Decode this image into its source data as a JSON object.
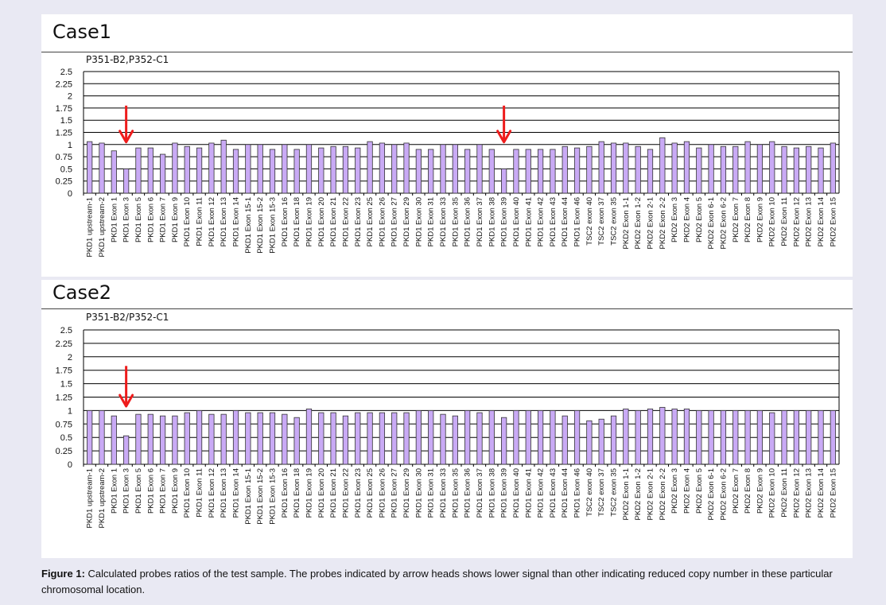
{
  "panels": [
    {
      "case_title": "Case1"
    },
    {
      "case_title": "Case2"
    }
  ],
  "caption": {
    "label": "Figure 1:",
    "text": "Calculated probes ratios of the test sample. The probes indicated by arrow heads shows lower signal than other indicating reduced copy number in these particular chromosomal location."
  },
  "colors": {
    "bar_fill": "#c9aaf5",
    "bar_stroke": "#333333",
    "arrow": "#ee1c1c",
    "grid": "#000000"
  },
  "chart_data": [
    {
      "type": "bar",
      "title": "P351-B2,P352-C1",
      "ylim": [
        0,
        2.5
      ],
      "yticks": [
        "0",
        "0.25",
        "0.5",
        "0.75",
        "1",
        "1.25",
        "1.5",
        "1.75",
        "2",
        "2.25",
        "2.5"
      ],
      "grid": true,
      "categories": [
        "PKD1 upstream-1",
        "PKD1 upstream-2",
        "PKD1 Exon 1",
        "PKD1 Exon 3",
        "PKD1 Exon 5",
        "PKD1 Exon 6",
        "PKD1 Exon 7",
        "PKD1 Exon 9",
        "PKD1 Exon 10",
        "PKD1 Exon 11",
        "PKD1 Exon 12",
        "PKD1 Exon 13",
        "PKD1 Exon 14",
        "PKD1 Exon 15-1",
        "PKD1 Exon 15-2",
        "PKD1 Exon 15-3",
        "PKD1 Exon 16",
        "PKD1 Exon 18",
        "PKD1 Exon 19",
        "PKD1 Exon 20",
        "PKD1 Exon 21",
        "PKD1 Exon 22",
        "PKD1 Exon 23",
        "PKD1 Exon 25",
        "PKD1 Exon 26",
        "PKD1 Exon 27",
        "PKD1 Exon 29",
        "PKD1 Exon 30",
        "PKD1 Exon 31",
        "PKD1 Exon 33",
        "PKD1 Exon 35",
        "PKD1 Exon 36",
        "PKD1 Exon 37",
        "PKD1 Exon 38",
        "PKD1 Exon 39",
        "PKD1 Exon 40",
        "PKD1 Exon 41",
        "PKD1 Exon 42",
        "PKD1 Exon 43",
        "PKD1 Exon 44",
        "PKD1 Exon 46",
        "TSC2 exon 40",
        "TSC2 exon 37",
        "TSC2 exon 35",
        "PKD2 Exon 1-1",
        "PKD2 Exon 1-2",
        "PKD2 Exon 2-1",
        "PKD2 Exon 2-2",
        "PKD2 Exon 3",
        "PKD2 Exon 4",
        "PKD2 Exon 5",
        "PKD2 Exon 6-1",
        "PKD2 Exon 6-2",
        "PKD2 Exon 7",
        "PKD2 Exon 8",
        "PKD2 Exon 9",
        "PKD2 Exon 10",
        "PKD2 Exon 11",
        "PKD2 Exon 12",
        "PKD2 Exon 13",
        "PKD2 Exon 14",
        "PKD2 Exon 15"
      ],
      "values": [
        1.06,
        1.03,
        0.87,
        0.5,
        0.93,
        0.93,
        0.8,
        1.03,
        0.96,
        0.93,
        1.03,
        1.09,
        0.9,
        1.0,
        1.0,
        0.9,
        1.0,
        0.9,
        1.0,
        0.93,
        0.96,
        0.96,
        0.93,
        1.06,
        1.03,
        1.0,
        1.03,
        0.9,
        0.9,
        1.0,
        1.0,
        0.9,
        1.0,
        0.9,
        0.5,
        0.9,
        0.9,
        0.9,
        0.9,
        0.96,
        0.93,
        0.96,
        1.06,
        1.03,
        1.03,
        0.96,
        0.9,
        1.14,
        1.03,
        1.06,
        0.93,
        1.0,
        0.96,
        0.96,
        1.06,
        1.0,
        1.06,
        0.96,
        0.93,
        0.96,
        0.93,
        1.03
      ],
      "arrows": [
        "PKD1 Exon 3",
        "PKD1 Exon 39"
      ]
    },
    {
      "type": "bar",
      "title": "P351-B2/P352-C1",
      "ylim": [
        0,
        2.5
      ],
      "yticks": [
        "0",
        "0.25",
        "0.5",
        "0.75",
        "1",
        "1.25",
        "1.5",
        "1.75",
        "2",
        "2.25",
        "2.5"
      ],
      "grid": true,
      "categories": [
        "PKD1 upstream-1",
        "PKD1 upstream-2",
        "PKD1 Exon 1",
        "PKD1 Exon 3",
        "PKD1 Exon 5",
        "PKD1 Exon 6",
        "PKD1 Exon 7",
        "PKD1 Exon 9",
        "PKD1 Exon 10",
        "PKD1 Exon 11",
        "PKD1 Exon 12",
        "PKD1 Exon 13",
        "PKD1 Exon 14",
        "PKD1 Exon 15-1",
        "PKD1 Exon 15-2",
        "PKD1 Exon 15-3",
        "PKD1 Exon 16",
        "PKD1 Exon 18",
        "PKD1 Exon 19",
        "PKD1 Exon 20",
        "PKD1 Exon 21",
        "PKD1 Exon 22",
        "PKD1 Exon 23",
        "PKD1 Exon 25",
        "PKD1 Exon 26",
        "PKD1 Exon 27",
        "PKD1 Exon 29",
        "PKD1 Exon 30",
        "PKD1 Exon 31",
        "PKD1 Exon 33",
        "PKD1 Exon 35",
        "PKD1 Exon 36",
        "PKD1 Exon 37",
        "PKD1 Exon 38",
        "PKD1 Exon 39",
        "PKD1 Exon 40",
        "PKD1 Exon 41",
        "PKD1 Exon 42",
        "PKD1 Exon 43",
        "PKD1 Exon 44",
        "PKD1 Exon 46",
        "TSC2 exon 40",
        "TSC2 exon 37",
        "TSC2 exon 35",
        "PKD2 Exon 1-1",
        "PKD2 Exon 1-2",
        "PKD2 Exon 2-1",
        "PKD2 Exon 2-2",
        "PKD2 Exon 3",
        "PKD2 Exon 4",
        "PKD2 Exon 5",
        "PKD2 Exon 6-1",
        "PKD2 Exon 6-2",
        "PKD2 Exon 7",
        "PKD2 Exon 8",
        "PKD2 Exon 9",
        "PKD2 Exon 10",
        "PKD2 Exon 11",
        "PKD2 Exon 12",
        "PKD2 Exon 13",
        "PKD2 Exon 14",
        "PKD2 Exon 15"
      ],
      "values": [
        1.0,
        1.0,
        0.9,
        0.53,
        0.93,
        0.93,
        0.9,
        0.9,
        0.96,
        1.0,
        0.93,
        0.93,
        1.0,
        0.96,
        0.96,
        0.96,
        0.93,
        0.87,
        1.03,
        0.96,
        0.96,
        0.9,
        0.96,
        0.96,
        0.96,
        0.96,
        0.96,
        1.0,
        1.0,
        0.93,
        0.9,
        1.0,
        0.96,
        1.0,
        0.87,
        1.0,
        1.0,
        1.0,
        1.0,
        0.9,
        1.0,
        0.81,
        0.84,
        0.9,
        1.03,
        1.0,
        1.03,
        1.06,
        1.03,
        1.03,
        1.0,
        1.0,
        1.0,
        1.0,
        1.0,
        1.0,
        0.96,
        1.0,
        1.0,
        1.0,
        1.0,
        1.0
      ],
      "arrows": [
        "PKD1 Exon 3"
      ]
    }
  ]
}
